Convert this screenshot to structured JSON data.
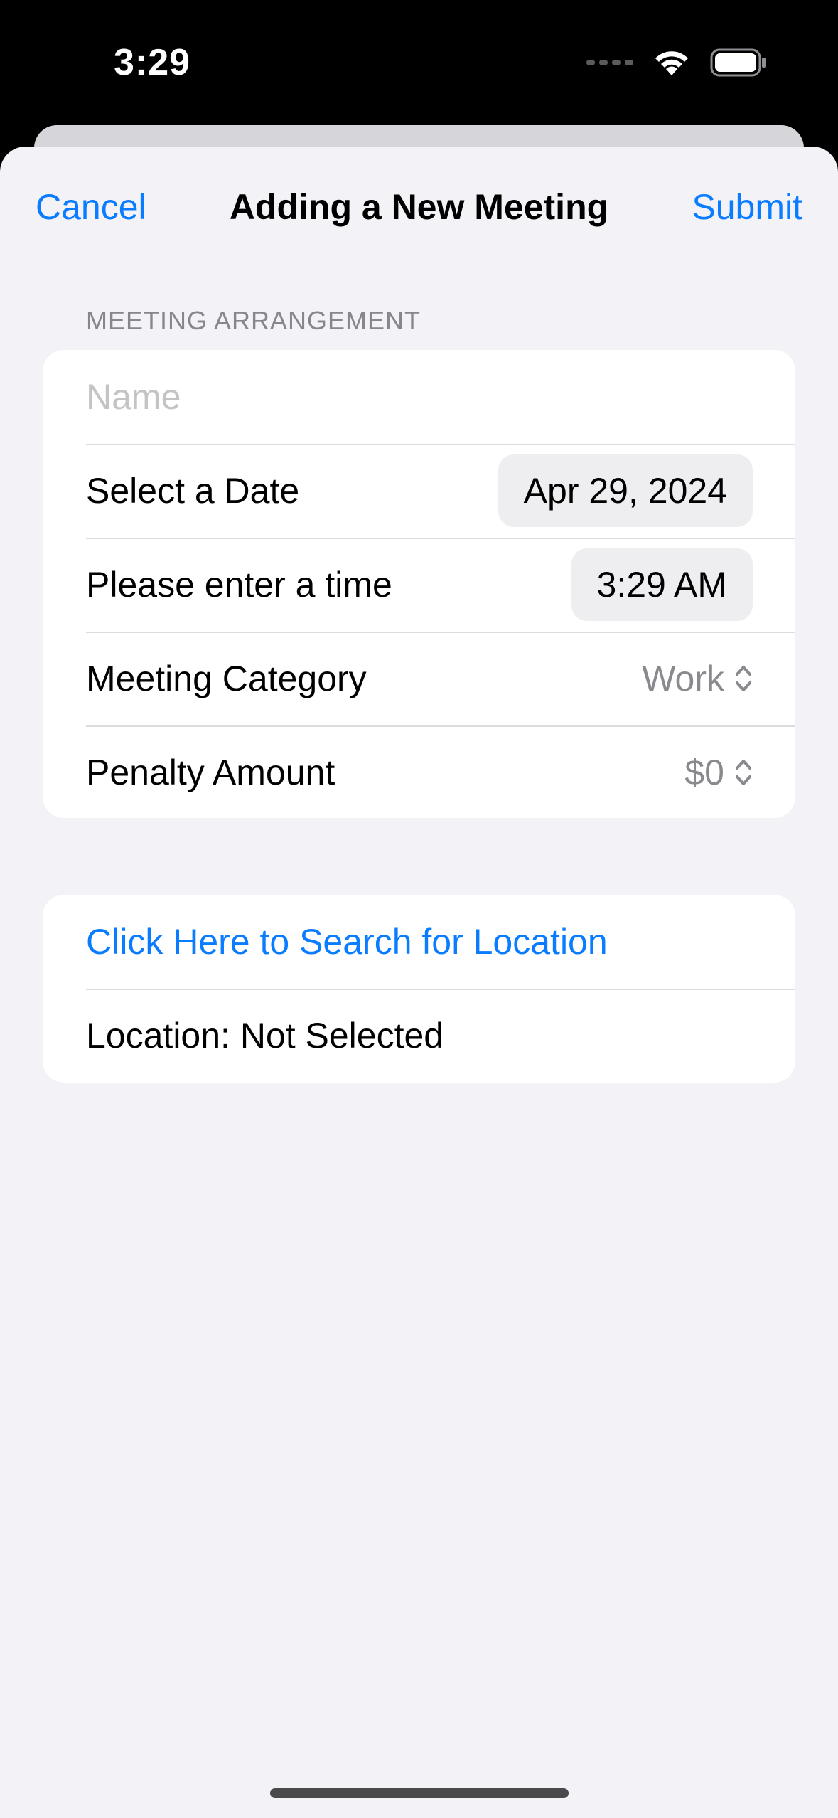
{
  "status_bar": {
    "time": "3:29"
  },
  "nav": {
    "cancel_label": "Cancel",
    "title": "Adding a New Meeting",
    "submit_label": "Submit"
  },
  "form": {
    "section_header": "MEETING ARRANGEMENT",
    "name_placeholder": "Name",
    "name_value": "",
    "date_label": "Select a Date",
    "date_value": "Apr 29, 2024",
    "time_label": "Please enter a time",
    "time_value": "3:29 AM",
    "category_label": "Meeting Category",
    "category_value": "Work",
    "penalty_label": "Penalty Amount",
    "penalty_value": "$0"
  },
  "location": {
    "search_label": "Click Here to Search for Location",
    "status_text": "Location: Not Selected"
  },
  "colors": {
    "accent": "#0a7cff",
    "background": "#f2f2f7",
    "secondary_text": "#8a8a8e"
  },
  "icons": {
    "signal": "cellular-signal-icon",
    "wifi": "wifi-icon",
    "battery": "battery-icon",
    "chevron": "chevron-up-down-icon"
  }
}
